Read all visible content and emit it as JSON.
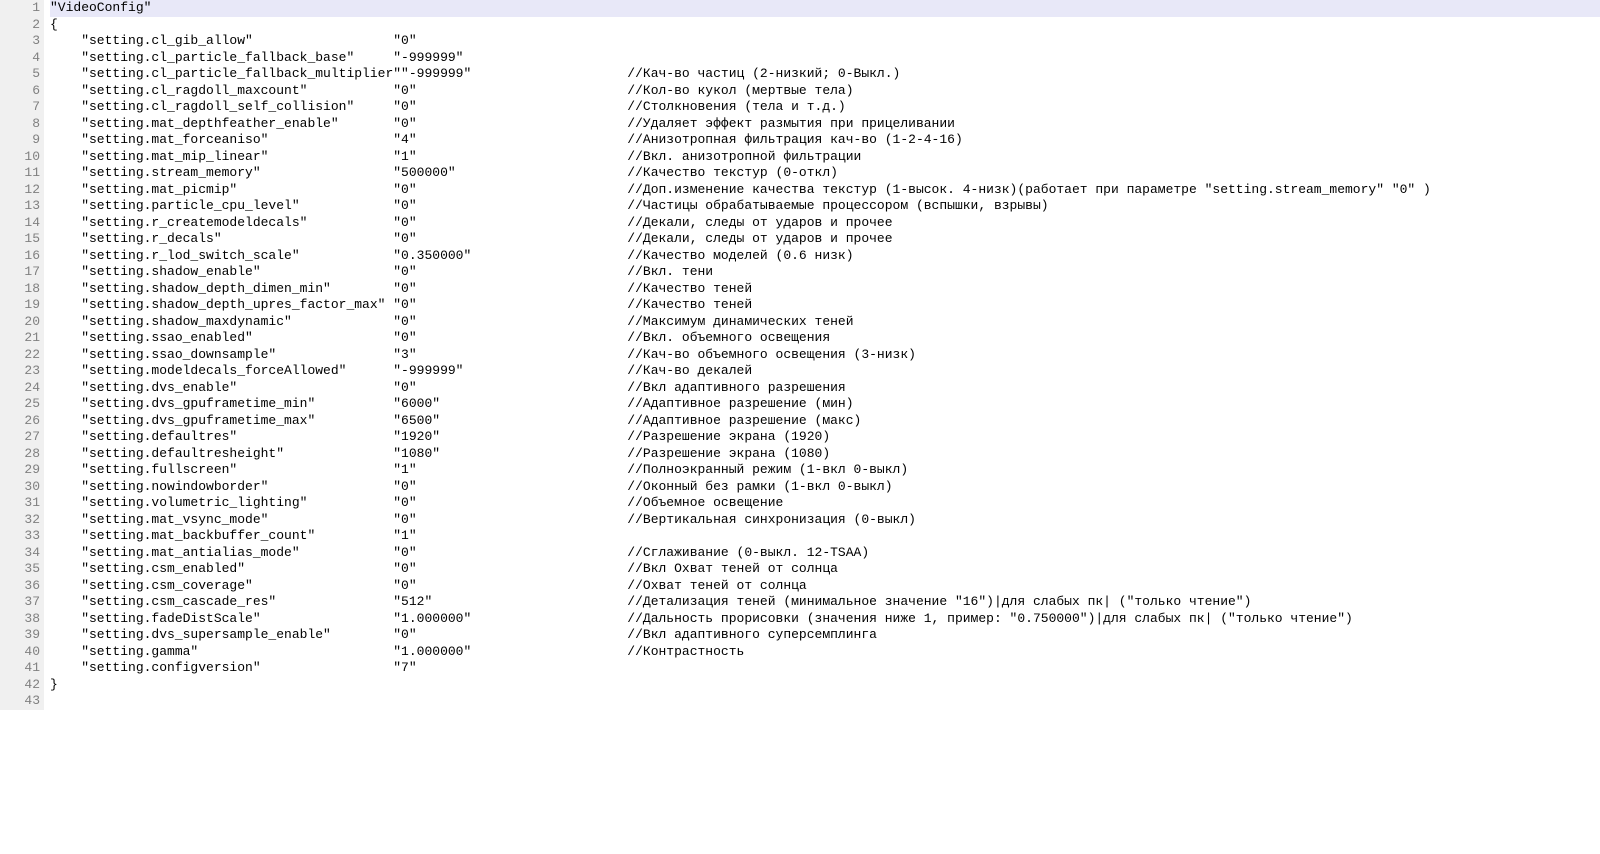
{
  "config_title": "VideoConfig",
  "settings": [
    {
      "key": "setting.cl_gib_allow",
      "value": "0",
      "comment": ""
    },
    {
      "key": "setting.cl_particle_fallback_base",
      "value": "-999999",
      "comment": ""
    },
    {
      "key": "setting.cl_particle_fallback_multiplier",
      "value": "-999999",
      "comment": "Кач-во частиц (2-низкий; 0-Выкл.)"
    },
    {
      "key": "setting.cl_ragdoll_maxcount",
      "value": "0",
      "comment": "Кол-во кукол (мертвые тела)"
    },
    {
      "key": "setting.cl_ragdoll_self_collision",
      "value": "0",
      "comment": "Столкновения (тела и т.д.)"
    },
    {
      "key": "setting.mat_depthfeather_enable",
      "value": "0",
      "comment": "Удаляет эффект размытия при прицеливании"
    },
    {
      "key": "setting.mat_forceaniso",
      "value": "4",
      "comment": "Анизотропная фильтрация кач-во (1-2-4-16)"
    },
    {
      "key": "setting.mat_mip_linear",
      "value": "1",
      "comment": "Вкл. анизотропной фильтрации"
    },
    {
      "key": "setting.stream_memory",
      "value": "500000",
      "comment": "Качество текстур (0-откл)"
    },
    {
      "key": "setting.mat_picmip",
      "value": "0",
      "comment": "Доп.изменение качества текстур (1-высок. 4-низк)(работает при параметре \"setting.stream_memory\" \"0\" )"
    },
    {
      "key": "setting.particle_cpu_level",
      "value": "0",
      "comment": "Частицы обрабатываемые процессором (вспышки, взрывы)"
    },
    {
      "key": "setting.r_createmodeldecals",
      "value": "0",
      "comment": "Декали, следы от ударов и прочее"
    },
    {
      "key": "setting.r_decals",
      "value": "0",
      "comment": "Декали, следы от ударов и прочее"
    },
    {
      "key": "setting.r_lod_switch_scale",
      "value": "0.350000",
      "comment": "Качество моделей (0.6 низк)"
    },
    {
      "key": "setting.shadow_enable",
      "value": "0",
      "comment": "Вкл. тени"
    },
    {
      "key": "setting.shadow_depth_dimen_min",
      "value": "0",
      "comment": "Качество теней"
    },
    {
      "key": "setting.shadow_depth_upres_factor_max",
      "value": "0",
      "comment": "Качество теней"
    },
    {
      "key": "setting.shadow_maxdynamic",
      "value": "0",
      "comment": "Максимум динамических теней"
    },
    {
      "key": "setting.ssao_enabled",
      "value": "0",
      "comment": "Вкл. объемного освещения"
    },
    {
      "key": "setting.ssao_downsample",
      "value": "3",
      "comment": "Кач-во объемного освещения (3-низк)"
    },
    {
      "key": "setting.modeldecals_forceAllowed",
      "value": "-999999",
      "comment": "Кач-во декалей"
    },
    {
      "key": "setting.dvs_enable",
      "value": "0",
      "comment": "Вкл адаптивного разрешения"
    },
    {
      "key": "setting.dvs_gpuframetime_min",
      "value": "6000",
      "comment": "Адаптивное разрешение (мин)"
    },
    {
      "key": "setting.dvs_gpuframetime_max",
      "value": "6500",
      "comment": "Адаптивное разрешение (макс)"
    },
    {
      "key": "setting.defaultres",
      "value": "1920",
      "comment": "Разрешение экрана (1920)"
    },
    {
      "key": "setting.defaultresheight",
      "value": "1080",
      "comment": "Разрешение экрана (1080)"
    },
    {
      "key": "setting.fullscreen",
      "value": "1",
      "comment": "Полноэкранный режим (1-вкл 0-выкл)"
    },
    {
      "key": "setting.nowindowborder",
      "value": "0",
      "comment": "Оконный без рамки (1-вкл 0-выкл)"
    },
    {
      "key": "setting.volumetric_lighting",
      "value": "0",
      "comment": "Объемное освещение"
    },
    {
      "key": "setting.mat_vsync_mode",
      "value": "0",
      "comment": "Вертикальная синхронизация (0-выкл)"
    },
    {
      "key": "setting.mat_backbuffer_count",
      "value": "1",
      "comment": ""
    },
    {
      "key": "setting.mat_antialias_mode",
      "value": "0",
      "comment": "Сглаживание (0-выкл. 12-TSAA)"
    },
    {
      "key": "setting.csm_enabled",
      "value": "0",
      "comment": "Вкл Охват теней от солнца"
    },
    {
      "key": "setting.csm_coverage",
      "value": "0",
      "comment": "Охват теней от солнца"
    },
    {
      "key": "setting.csm_cascade_res",
      "value": "512",
      "comment": "Детализация теней (минимальное значение \"16\")|для слабых пк| (\"только чтение\")"
    },
    {
      "key": "setting.fadeDistScale",
      "value": "1.000000",
      "comment": "Дальность прорисовки (значения ниже 1, пример: \"0.750000\")|для слабых пк| (\"только чтение\")"
    },
    {
      "key": "setting.dvs_supersample_enable",
      "value": "0",
      "comment": "Вкл адаптивного суперсемплинга"
    },
    {
      "key": "setting.gamma",
      "value": "1.000000",
      "comment": "Контрастность"
    },
    {
      "key": "setting.configversion",
      "value": "7",
      "comment": ""
    }
  ],
  "layout": {
    "indent": "    ",
    "value_col": 44,
    "comment_col": 74,
    "total_lines": 43
  },
  "tokens": {
    "open_brace": "{",
    "close_brace": "}",
    "comment_prefix": "//"
  }
}
